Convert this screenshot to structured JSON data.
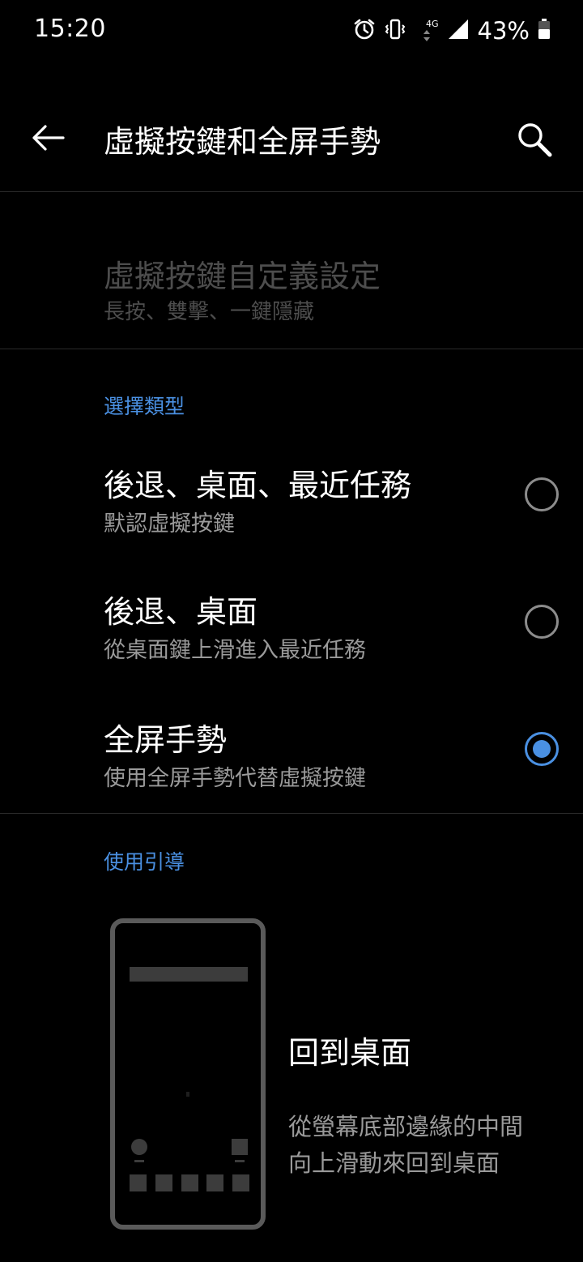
{
  "status_bar": {
    "time": "15:20",
    "network": "4G",
    "battery": "43%",
    "icons": [
      "alarm-icon",
      "vibrate-icon",
      "data-arrows-icon",
      "signal-icon",
      "battery-icon"
    ]
  },
  "app_bar": {
    "title": "虛擬按鍵和全屏手勢",
    "back_icon": "arrow-left-icon",
    "search_icon": "search-icon"
  },
  "customize_item": {
    "title": "虛擬按鍵自定義設定",
    "subtitle": "長按、雙擊、一鍵隱藏"
  },
  "select_type": {
    "header": "選擇類型",
    "options": [
      {
        "title": "後退、桌面、最近任務",
        "subtitle": "默認虛擬按鍵",
        "selected": false
      },
      {
        "title": "後退、桌面",
        "subtitle": "從桌面鍵上滑進入最近任務",
        "selected": false
      },
      {
        "title": "全屏手勢",
        "subtitle": "使用全屏手勢代替虛擬按鍵",
        "selected": true
      }
    ]
  },
  "guide": {
    "header": "使用引導",
    "title": "回到桌面",
    "desc_line1": "從螢幕底部邊緣的中間",
    "desc_line2": "向上滑動來回到桌面"
  },
  "colors": {
    "background": "#000000",
    "accent": "#4a90e2",
    "secondary_text": "#9a9a9a",
    "disabled_text": "#4d4d4d"
  }
}
